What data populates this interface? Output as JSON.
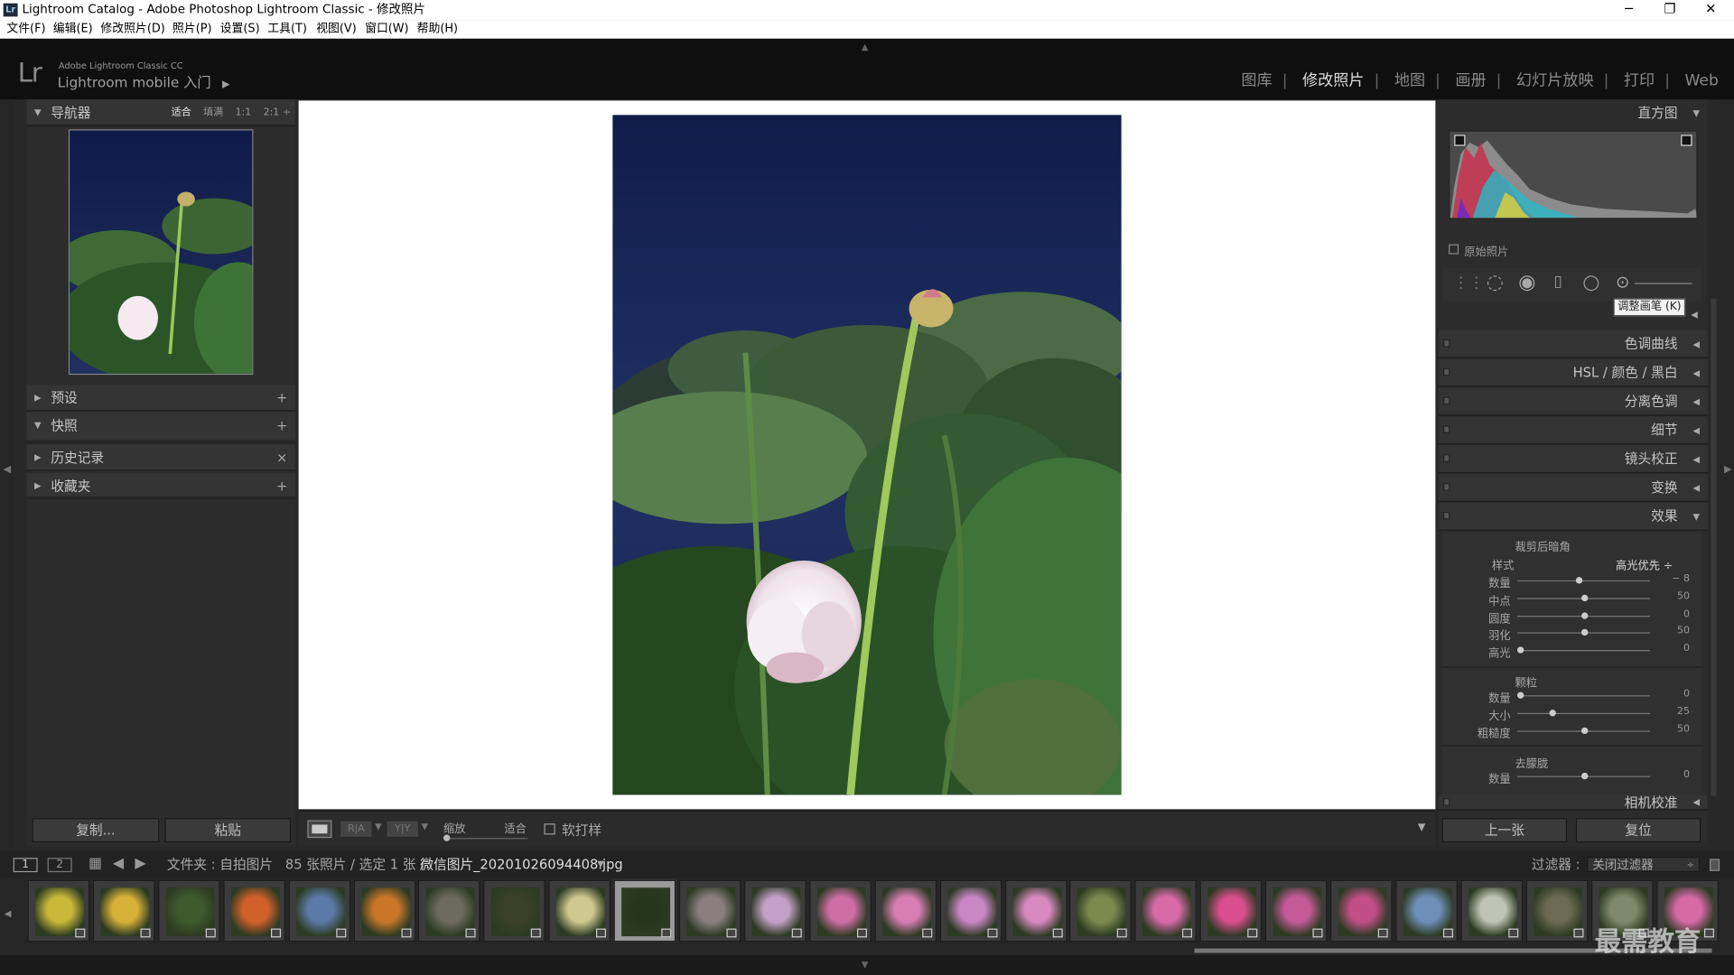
{
  "window": {
    "title": "Lightroom Catalog - Adobe Photoshop Lightroom Classic - 修改照片",
    "app_icon": "Lr",
    "minimize": "─",
    "maximize": "❐",
    "close": "✕"
  },
  "menu": [
    "文件(F)",
    "编辑(E)",
    "修改照片(D)",
    "照片(P)",
    "设置(S)",
    "工具(T)",
    "视图(V)",
    "窗口(W)",
    "帮助(H)"
  ],
  "identity": {
    "logo": "Lr",
    "small": "Adobe Lightroom Classic CC",
    "big": "Lightroom mobile 入门",
    "arrow": "▶"
  },
  "modules": [
    {
      "label": "图库",
      "active": false
    },
    {
      "label": "修改照片",
      "active": true
    },
    {
      "label": "地图",
      "active": false
    },
    {
      "label": "画册",
      "active": false
    },
    {
      "label": "幻灯片放映",
      "active": false
    },
    {
      "label": "打印",
      "active": false
    },
    {
      "label": "Web",
      "active": false
    }
  ],
  "left_panel": {
    "navigator": {
      "label": "导航器",
      "options": [
        "适合",
        "填满",
        "1:1",
        "2:1 ÷"
      ],
      "active": "适合"
    },
    "sections": [
      {
        "label": "预设",
        "expanded": false,
        "action": "+"
      },
      {
        "label": "快照",
        "expanded": true,
        "action": "+"
      },
      {
        "label": "历史记录",
        "expanded": false,
        "action": "×"
      },
      {
        "label": "收藏夹",
        "expanded": false,
        "action": "+"
      }
    ],
    "copy_label": "复制...",
    "paste_label": "粘贴"
  },
  "toolbar": {
    "zoom_label": "缩放",
    "fit_label": "适合",
    "softproof_label": "软打样",
    "view_ab": "R|A",
    "view_yy": "Y|Y"
  },
  "right_panel": {
    "histogram": {
      "label": "直方图",
      "original_photo": "原始照片"
    },
    "tooltip": "调整画笔 (K)",
    "sections": [
      {
        "label": "色调曲线"
      },
      {
        "label": "HSL / 颜色 / 黑白"
      },
      {
        "label": "分离色调"
      },
      {
        "label": "细节"
      },
      {
        "label": "镜头校正"
      },
      {
        "label": "变换"
      },
      {
        "label": "效果"
      },
      {
        "label": "相机校准"
      }
    ],
    "effects": {
      "vignette_title": "裁剪后暗角",
      "style_label": "样式",
      "style_value": "高光优先 ÷",
      "vignette_sliders": [
        {
          "label": "数量",
          "value": "− 8",
          "fraction": 0.46
        },
        {
          "label": "中点",
          "value": "50",
          "fraction": 0.5
        },
        {
          "label": "圆度",
          "value": "0",
          "fraction": 0.5
        },
        {
          "label": "羽化",
          "value": "50",
          "fraction": 0.5
        },
        {
          "label": "高光",
          "value": "0",
          "fraction": 0.0
        }
      ],
      "grain_title": "颗粒",
      "grain_sliders": [
        {
          "label": "数量",
          "value": "0",
          "fraction": 0.0
        },
        {
          "label": "大小",
          "value": "25",
          "fraction": 0.25
        },
        {
          "label": "粗糙度",
          "value": "50",
          "fraction": 0.5
        }
      ],
      "dehaze_title": "去朦胧",
      "dehaze_sliders": [
        {
          "label": "数量",
          "value": "0",
          "fraction": 0.5
        }
      ]
    },
    "prev_label": "上一张",
    "reset_label": "复位"
  },
  "filmstrip": {
    "page1": "1",
    "page2": "2",
    "source": "文件夹 : 自拍图片",
    "count": "85 张照片 / 选定 1 张 /",
    "filename": "微信图片_20201026094408.jpg",
    "filter_label": "过滤器 :",
    "filter_value": "关闭过滤器",
    "thumbs": [
      "#c9b83a",
      "#d8b238",
      "#3f5a2d",
      "#d2602a",
      "#5c7aa8",
      "#c97628",
      "#6d6a5e",
      "#3b4128",
      "#cfc98f",
      "#25361f",
      "#8a7f80",
      "#c4a1c8",
      "#cf6ea6",
      "#d77eb4",
      "#c987c6",
      "#d889c0",
      "#7d8a4f",
      "#d96aa8",
      "#d94e8e",
      "#c55a98",
      "#c14e86",
      "#6d8fb8",
      "#bfc4b4",
      "#6c6a52",
      "#7f8a6c",
      "#d66aa6"
    ]
  },
  "watermark": "最需教育",
  "colors": {
    "accent": "#dcdcdc",
    "panel": "#2c2c2c",
    "viewer_bg": "#ffffff"
  }
}
